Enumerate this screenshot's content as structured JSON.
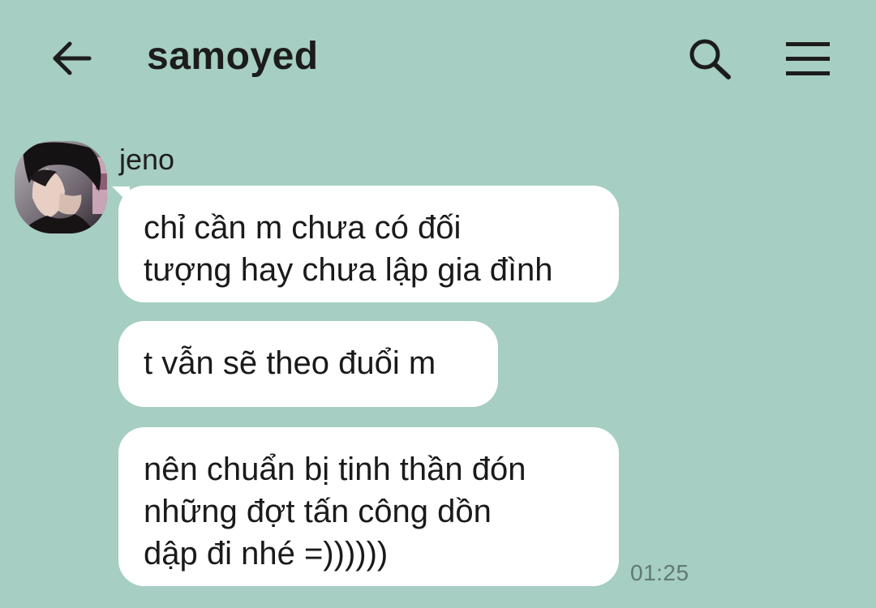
{
  "header": {
    "title": "samoyed",
    "back_icon": "arrow-left-icon",
    "search_icon": "search-icon",
    "menu_icon": "hamburger-menu-icon"
  },
  "conversation": {
    "sender": "jeno",
    "avatar_icon": "avatar-photo",
    "messages": [
      {
        "text": "chỉ cần m chưa có đối\ntượng hay chưa lập gia đình"
      },
      {
        "text": "t vẫn sẽ theo đuổi m"
      },
      {
        "text": "nên chuẩn bị tinh thần đón\nnhững đợt tấn công dồn\ndập đi nhé =))))))"
      }
    ],
    "timestamp": "01:25"
  },
  "colors": {
    "background": "#a6cec2",
    "bubble": "#ffffff",
    "text": "#1a1a1a",
    "timestamp": "#5f7a74"
  }
}
